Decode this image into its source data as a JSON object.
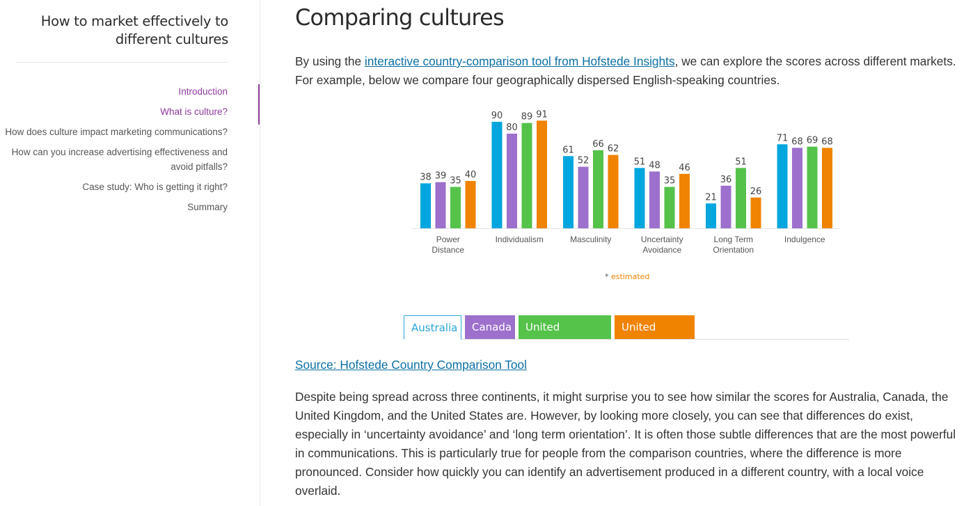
{
  "sidebar": {
    "title": "How to market effectively to different cultures",
    "nav": [
      {
        "label": "Introduction",
        "state": "visited"
      },
      {
        "label": "What is culture?",
        "state": "active"
      },
      {
        "label": "How does culture impact marketing communications?",
        "state": "default"
      },
      {
        "label": "How can you increase advertising effectiveness and avoid pitfalls?",
        "state": "default"
      },
      {
        "label": "Case study: Who is getting it right?",
        "state": "default"
      },
      {
        "label": "Summary",
        "state": "default"
      }
    ]
  },
  "main": {
    "title": "Comparing cultures",
    "intro_before": "By using the ",
    "intro_link": "interactive country-comparison tool from Hofstede Insights",
    "intro_after": ", we can explore the scores across different markets. For example, below we compare four geographically dispersed English-speaking countries.",
    "estimated_star": "*",
    "estimated_label": "estimated",
    "source_link": "Source: Hofstede Country Comparison Tool",
    "body": "Despite being spread across three continents, it might surprise you to see how similar the scores for Australia, Canada, the United Kingdom, and the United States are. However, by looking more closely, you can see that differences do exist, especially in ‘uncertainty avoidance’ and ‘long term orientation’. It is often those subtle differences that are the most powerful in communications. This is particularly true for people from the comparison countries, where the difference is more pronounced. Consider how quickly you can identify an advertisement produced in a different country, with a local voice overlaid."
  },
  "tabs": [
    {
      "label": "Australia",
      "color": "#00a6dd",
      "active": true
    },
    {
      "label": "Canada",
      "color": "#9c70cc",
      "active": false
    },
    {
      "label": "United Kingdom",
      "color": "#55c24a",
      "active": false
    },
    {
      "label": "United States",
      "color": "#f08300",
      "active": false
    }
  ],
  "chart_data": {
    "type": "bar",
    "title": "",
    "xlabel": "",
    "ylabel": "",
    "ylim": [
      0,
      100
    ],
    "grid": false,
    "legend": "bottom (tabs)",
    "categories": [
      [
        "Power",
        "Distance"
      ],
      [
        "Individualism"
      ],
      [
        "Masculinity"
      ],
      [
        "Uncertainty",
        "Avoidance"
      ],
      [
        "Long Term",
        "Orientation"
      ],
      [
        "Indulgence"
      ]
    ],
    "series": [
      {
        "name": "Australia",
        "color": "#00a6dd",
        "values": [
          38,
          90,
          61,
          51,
          21,
          71
        ]
      },
      {
        "name": "Canada",
        "color": "#9c70cc",
        "values": [
          39,
          80,
          52,
          48,
          36,
          68
        ]
      },
      {
        "name": "United Kingdom",
        "color": "#55c24a",
        "values": [
          35,
          89,
          66,
          35,
          51,
          69
        ]
      },
      {
        "name": "United States",
        "color": "#f08300",
        "values": [
          40,
          91,
          62,
          46,
          26,
          68
        ]
      }
    ]
  }
}
